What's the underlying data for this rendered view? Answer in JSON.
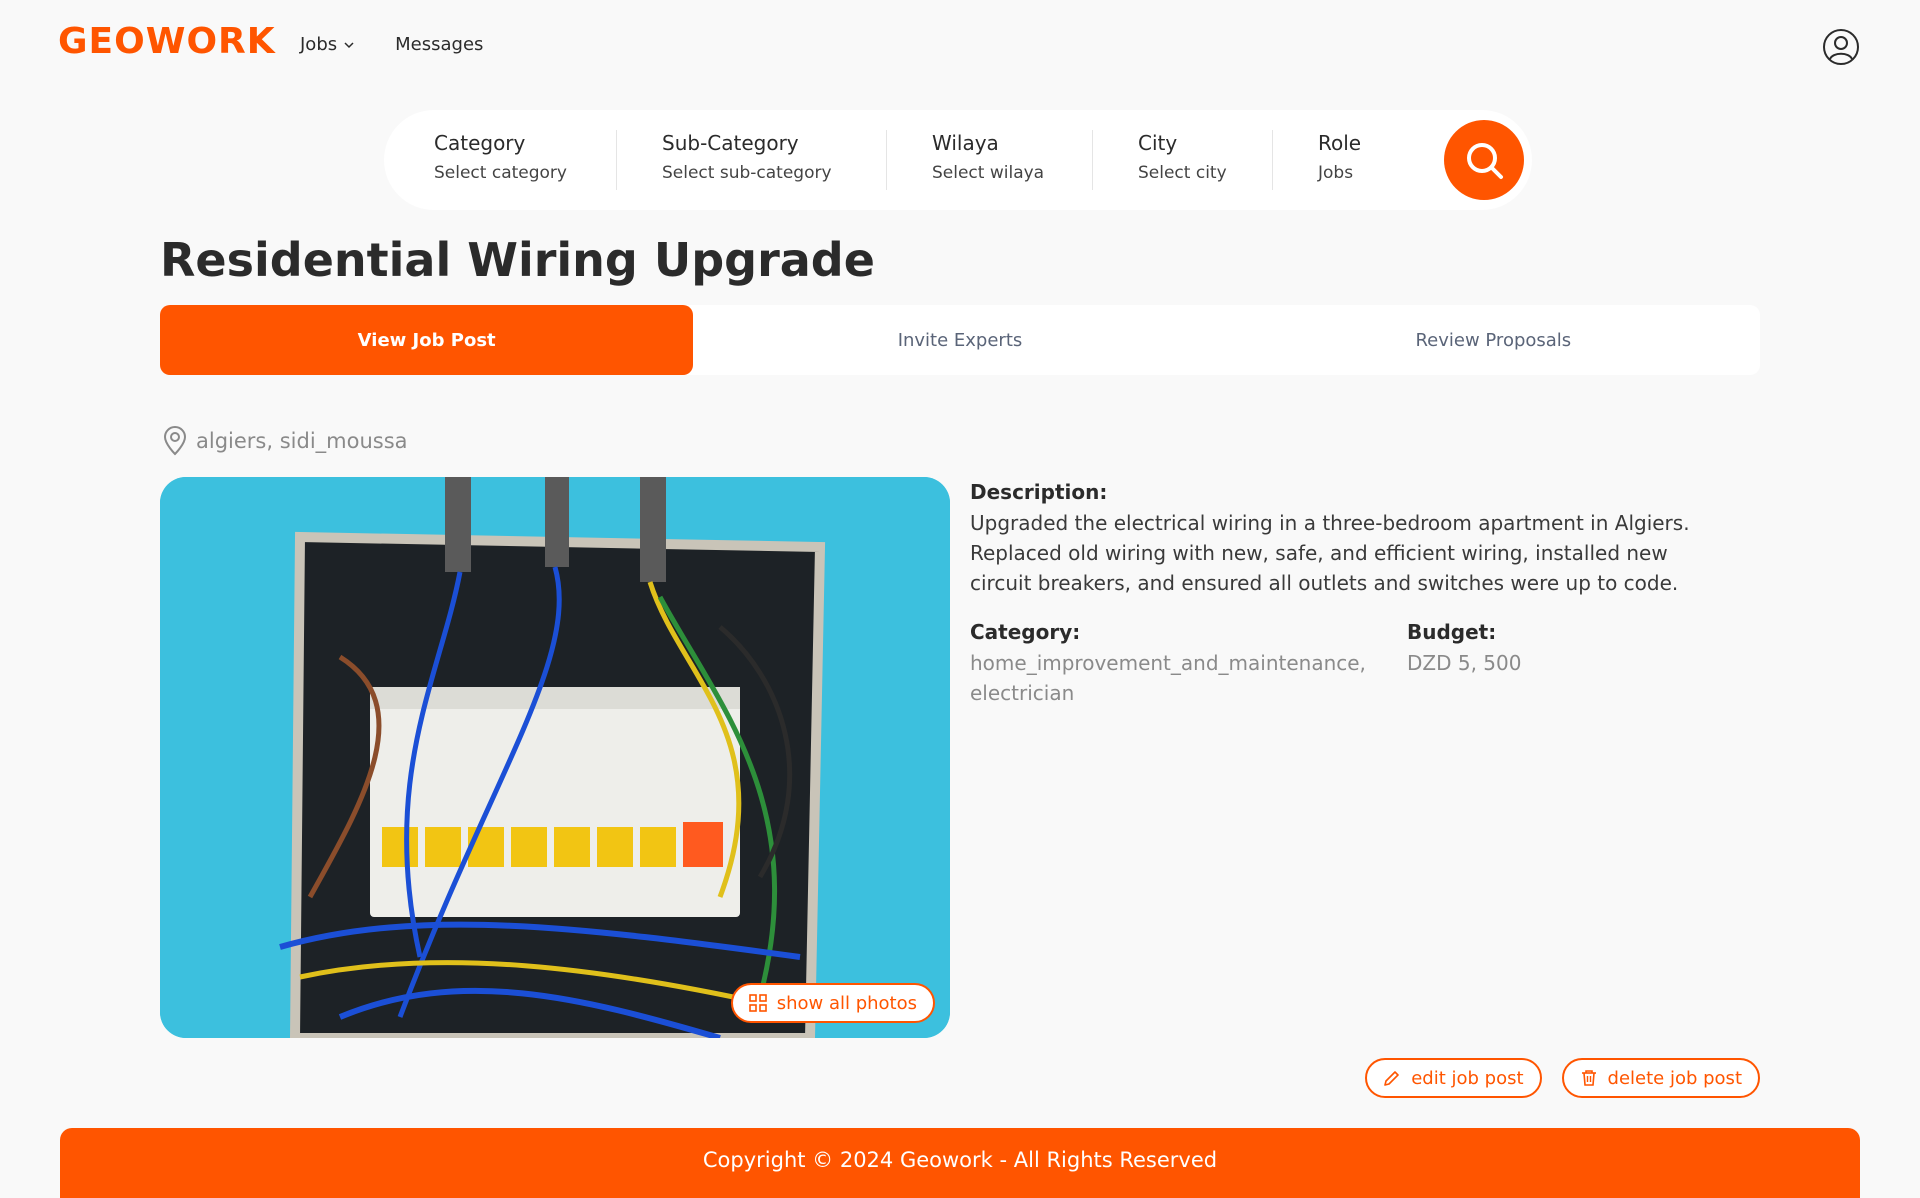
{
  "header": {
    "logo_text": "GEOWORK",
    "nav": {
      "jobs_label": "Jobs",
      "messages_label": "Messages"
    }
  },
  "search": {
    "fields": [
      {
        "label": "Category",
        "value": "Select category"
      },
      {
        "label": "Sub-Category",
        "value": "Select sub-category"
      },
      {
        "label": "Wilaya",
        "value": "Select wilaya"
      },
      {
        "label": "City",
        "value": "Select city"
      },
      {
        "label": "Role",
        "value": "Jobs"
      }
    ]
  },
  "job": {
    "title": "Residential Wiring Upgrade",
    "location": "algiers, sidi_moussa",
    "description_label": "Description:",
    "description": "Upgraded the electrical wiring in a three-bedroom apartment in Algiers. Replaced old wiring with new, safe, and efficient wiring, installed new circuit breakers, and ensured all outlets and switches were up to code.",
    "category_label": "Category:",
    "category_value": "home_improvement_and_maintenance, electrician",
    "budget_label": "Budget:",
    "budget_value": "DZD 5, 500",
    "show_photos_label": "show all photos"
  },
  "tabs": [
    {
      "label": "View Job Post",
      "active": true
    },
    {
      "label": "Invite Experts",
      "active": false
    },
    {
      "label": "Review Proposals",
      "active": false
    }
  ],
  "actions": {
    "edit_label": "edit job post",
    "delete_label": "delete job post"
  },
  "footer": {
    "copyright": "Copyright © 2024 Geowork - All Rights Reserved"
  },
  "colors": {
    "accent": "#ff5500",
    "photo_bg": "#3cc0de"
  },
  "icons": [
    "chevron-down-icon",
    "user-circle-icon",
    "search-icon",
    "location-pin-icon",
    "grid-icon",
    "pencil-icon",
    "trash-icon"
  ]
}
